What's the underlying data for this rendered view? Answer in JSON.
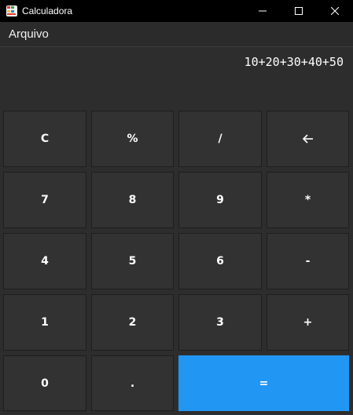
{
  "window": {
    "title": "Calculadora",
    "icons": {
      "app": "calculator-app-icon",
      "minimize": "minimize-icon",
      "maximize": "maximize-icon",
      "close": "close-icon"
    }
  },
  "menu": {
    "file_label": "Arquivo"
  },
  "display": {
    "expression": "10+20+30+40+50"
  },
  "keys": {
    "clear": "C",
    "percent": "%",
    "divide": "/",
    "seven": "7",
    "eight": "8",
    "nine": "9",
    "multiply": "*",
    "four": "4",
    "five": "5",
    "six": "6",
    "subtract": "-",
    "one": "1",
    "two": "2",
    "three": "3",
    "add": "+",
    "zero": "0",
    "decimal": ".",
    "equals": "="
  },
  "colors": {
    "titlebar": "#000000",
    "background": "#2d2d2d",
    "key": "#323232",
    "key_border": "#1e1e1e",
    "accent": "#2196f3"
  }
}
